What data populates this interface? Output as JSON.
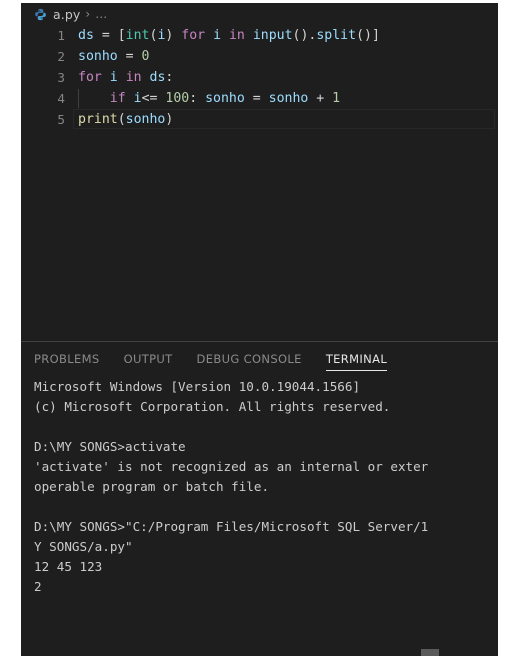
{
  "window": {
    "theme_background": "#1e1e1e",
    "foreground": "#d4d4d4"
  },
  "breadcrumb": {
    "icon": "python-file-icon",
    "file": "a.py",
    "separator": "›",
    "overflow": "…"
  },
  "editor": {
    "language": "python",
    "active_line": 5,
    "lines": [
      {
        "number": "1",
        "text": "ds = [int(i) for i in input().split()]",
        "tokens": [
          {
            "text": "ds",
            "cls": "t-var"
          },
          {
            "text": " = ",
            "cls": "t-op"
          },
          {
            "text": "[",
            "cls": "t-punct"
          },
          {
            "text": "int",
            "cls": "t-type"
          },
          {
            "text": "(",
            "cls": "t-punct"
          },
          {
            "text": "i",
            "cls": "t-var"
          },
          {
            "text": ") ",
            "cls": "t-punct"
          },
          {
            "text": "for",
            "cls": "t-kw"
          },
          {
            "text": " ",
            "cls": "t-plain"
          },
          {
            "text": "i",
            "cls": "t-var"
          },
          {
            "text": " ",
            "cls": "t-plain"
          },
          {
            "text": "in",
            "cls": "t-kw"
          },
          {
            "text": " ",
            "cls": "t-plain"
          },
          {
            "text": "input",
            "cls": "t-var"
          },
          {
            "text": "().",
            "cls": "t-punct"
          },
          {
            "text": "split",
            "cls": "t-var"
          },
          {
            "text": "()]",
            "cls": "t-punct"
          }
        ]
      },
      {
        "number": "2",
        "text": "sonho = 0",
        "tokens": [
          {
            "text": "sonho",
            "cls": "t-var"
          },
          {
            "text": " = ",
            "cls": "t-op"
          },
          {
            "text": "0",
            "cls": "t-num"
          }
        ]
      },
      {
        "number": "3",
        "text": "for i in ds:",
        "tokens": [
          {
            "text": "for",
            "cls": "t-kw"
          },
          {
            "text": " ",
            "cls": "t-plain"
          },
          {
            "text": "i",
            "cls": "t-var"
          },
          {
            "text": " ",
            "cls": "t-plain"
          },
          {
            "text": "in",
            "cls": "t-kw"
          },
          {
            "text": " ",
            "cls": "t-plain"
          },
          {
            "text": "ds",
            "cls": "t-var"
          },
          {
            "text": ":",
            "cls": "t-punct"
          }
        ]
      },
      {
        "number": "4",
        "text": "    if i<= 100: sonho = sonho + 1",
        "tokens": [
          {
            "text": "    ",
            "cls": "t-plain"
          },
          {
            "text": "if",
            "cls": "t-kw"
          },
          {
            "text": " ",
            "cls": "t-plain"
          },
          {
            "text": "i",
            "cls": "t-var"
          },
          {
            "text": "<= ",
            "cls": "t-op"
          },
          {
            "text": "100",
            "cls": "t-num"
          },
          {
            "text": ": ",
            "cls": "t-punct"
          },
          {
            "text": "sonho",
            "cls": "t-var"
          },
          {
            "text": " = ",
            "cls": "t-op"
          },
          {
            "text": "sonho",
            "cls": "t-var"
          },
          {
            "text": " + ",
            "cls": "t-op"
          },
          {
            "text": "1",
            "cls": "t-num"
          }
        ]
      },
      {
        "number": "5",
        "text": "print(sonho)",
        "tokens": [
          {
            "text": "print",
            "cls": "t-func"
          },
          {
            "text": "(",
            "cls": "t-punct"
          },
          {
            "text": "sonho",
            "cls": "t-var"
          },
          {
            "text": ")",
            "cls": "t-punct"
          }
        ]
      }
    ]
  },
  "panel": {
    "tabs": [
      {
        "label": "PROBLEMS",
        "active": false
      },
      {
        "label": "OUTPUT",
        "active": false
      },
      {
        "label": "DEBUG CONSOLE",
        "active": false
      },
      {
        "label": "TERMINAL",
        "active": true
      }
    ]
  },
  "terminal": {
    "lines": [
      "Microsoft Windows [Version 10.0.19044.1566]",
      "(c) Microsoft Corporation. All rights reserved.",
      "",
      "D:\\MY SONGS>activate",
      "'activate' is not recognized as an internal or exter",
      "operable program or batch file.",
      "",
      "D:\\MY SONGS>\"C:/Program Files/Microsoft SQL Server/1",
      "Y SONGS/a.py\"",
      "12 45 123",
      "2"
    ]
  }
}
